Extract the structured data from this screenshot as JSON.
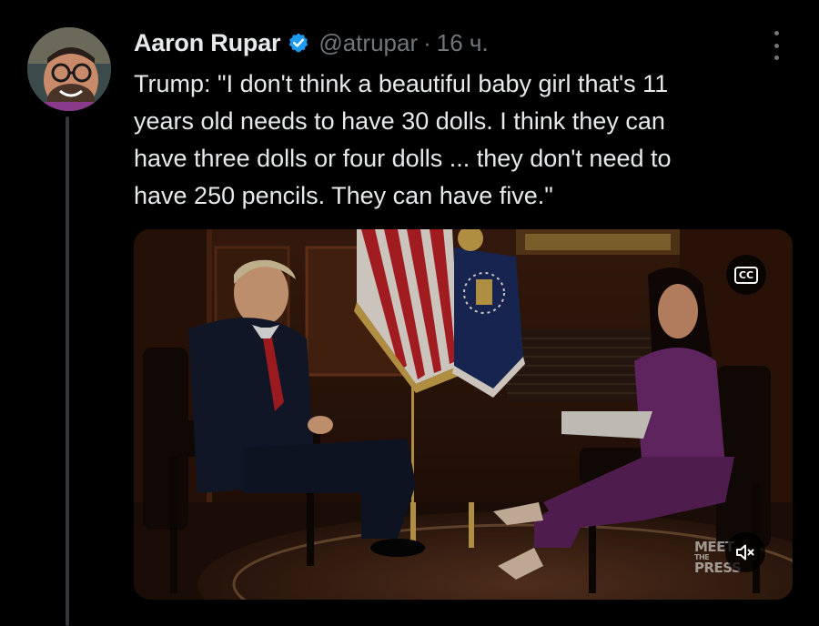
{
  "tweet": {
    "author": {
      "name": "Aaron Rupar",
      "handle": "@atrupar",
      "verified": true
    },
    "separator": "·",
    "timestamp": "16 ч.",
    "text_lines": [
      "Trump: \"I don't think a beautiful baby girl that's 11",
      "years old needs to have 30 dolls. I think they can",
      "have three dolls or four dolls ... they don't need to",
      "have 250 pencils. They can have five.\""
    ]
  },
  "media": {
    "type": "video",
    "cc_label": "CC",
    "watermark_line1": "MEET",
    "watermark_line2": "THE",
    "watermark_line3": "PRESS"
  },
  "colors": {
    "background": "#000000",
    "primary_text": "#e7e9ea",
    "secondary_text": "#71767b",
    "verified_blue": "#1d9bf0",
    "thread_line": "#333639"
  },
  "icons": {
    "verified": "verified-badge-icon",
    "more": "more-options-icon",
    "cc": "closed-captions-icon",
    "mute": "muted-speaker-icon"
  }
}
